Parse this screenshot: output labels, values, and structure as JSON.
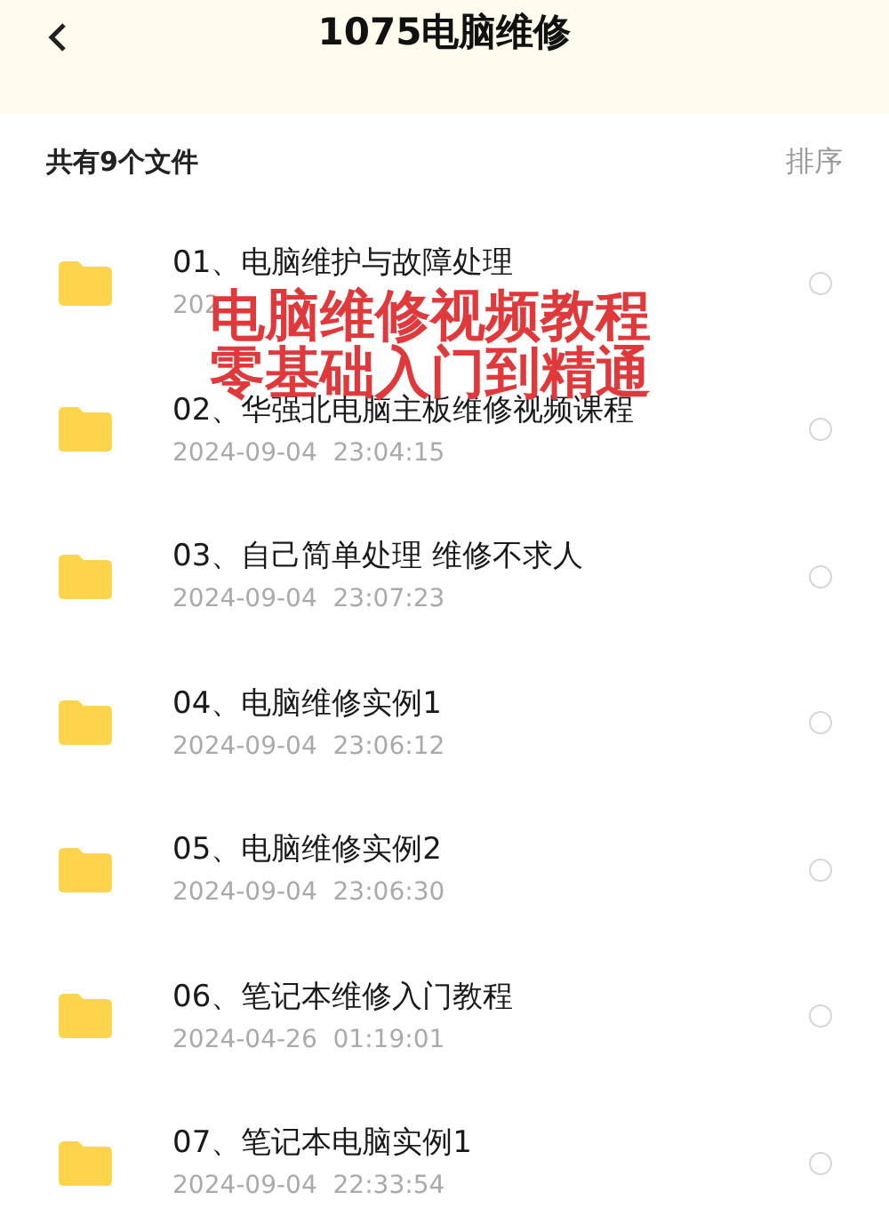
{
  "header": {
    "title": "1075电脑维修"
  },
  "summary": {
    "count_label": "共有9个文件",
    "sort_label": "排序"
  },
  "files": [
    {
      "name": "01、电脑维护与故障处理",
      "date": "202",
      "selected": false
    },
    {
      "name": "02、华强北电脑主板维修视频课程",
      "date": "2024-09-04  23:04:15",
      "selected": false
    },
    {
      "name": "03、自己简单处理 维修不求人",
      "date": "2024-09-04  23:07:23",
      "selected": false
    },
    {
      "name": "04、电脑维修实例1",
      "date": "2024-09-04  23:06:12",
      "selected": false
    },
    {
      "name": "05、电脑维修实例2",
      "date": "2024-09-04  23:06:30",
      "selected": false
    },
    {
      "name": "06、笔记本维修入门教程",
      "date": "2024-04-26  01:19:01",
      "selected": false
    },
    {
      "name": "07、笔记本电脑实例1",
      "date": "2024-09-04  22:33:54",
      "selected": false
    }
  ],
  "overlay": {
    "lines": [
      "电脑维修视频教程",
      "零基础入门到精通"
    ]
  }
}
